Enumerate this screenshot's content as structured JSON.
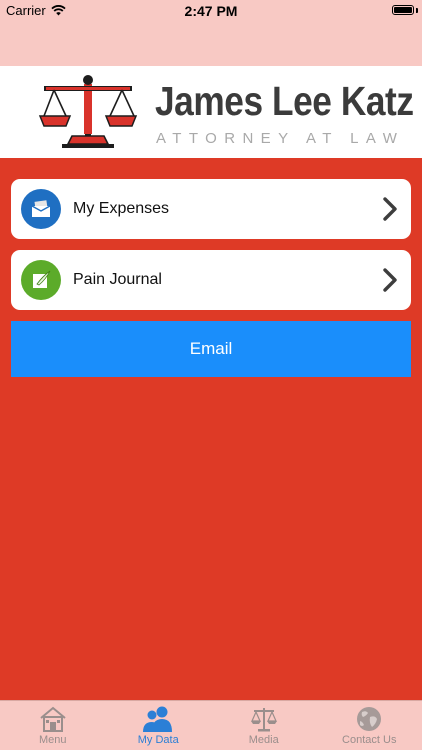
{
  "status": {
    "carrier": "Carrier",
    "time": "2:47 PM"
  },
  "banner": {
    "name": "James Lee Katz",
    "tagline": "ATTORNEY AT LAW"
  },
  "items": [
    {
      "label": "My Expenses",
      "icon": "wallet-icon",
      "color": "#1f6fc2"
    },
    {
      "label": "Pain Journal",
      "icon": "journal-icon",
      "color": "#5cab2a"
    }
  ],
  "email_label": "Email",
  "tabs": [
    {
      "label": "Menu",
      "icon": "home-icon",
      "active": false
    },
    {
      "label": "My Data",
      "icon": "people-icon",
      "active": true
    },
    {
      "label": "Media",
      "icon": "scales-icon",
      "active": false
    },
    {
      "label": "Contact Us",
      "icon": "globe-icon",
      "active": false
    }
  ],
  "colors": {
    "background": "#de3a26",
    "bars": "#f8c9c4",
    "accent": "#1a8efb"
  }
}
